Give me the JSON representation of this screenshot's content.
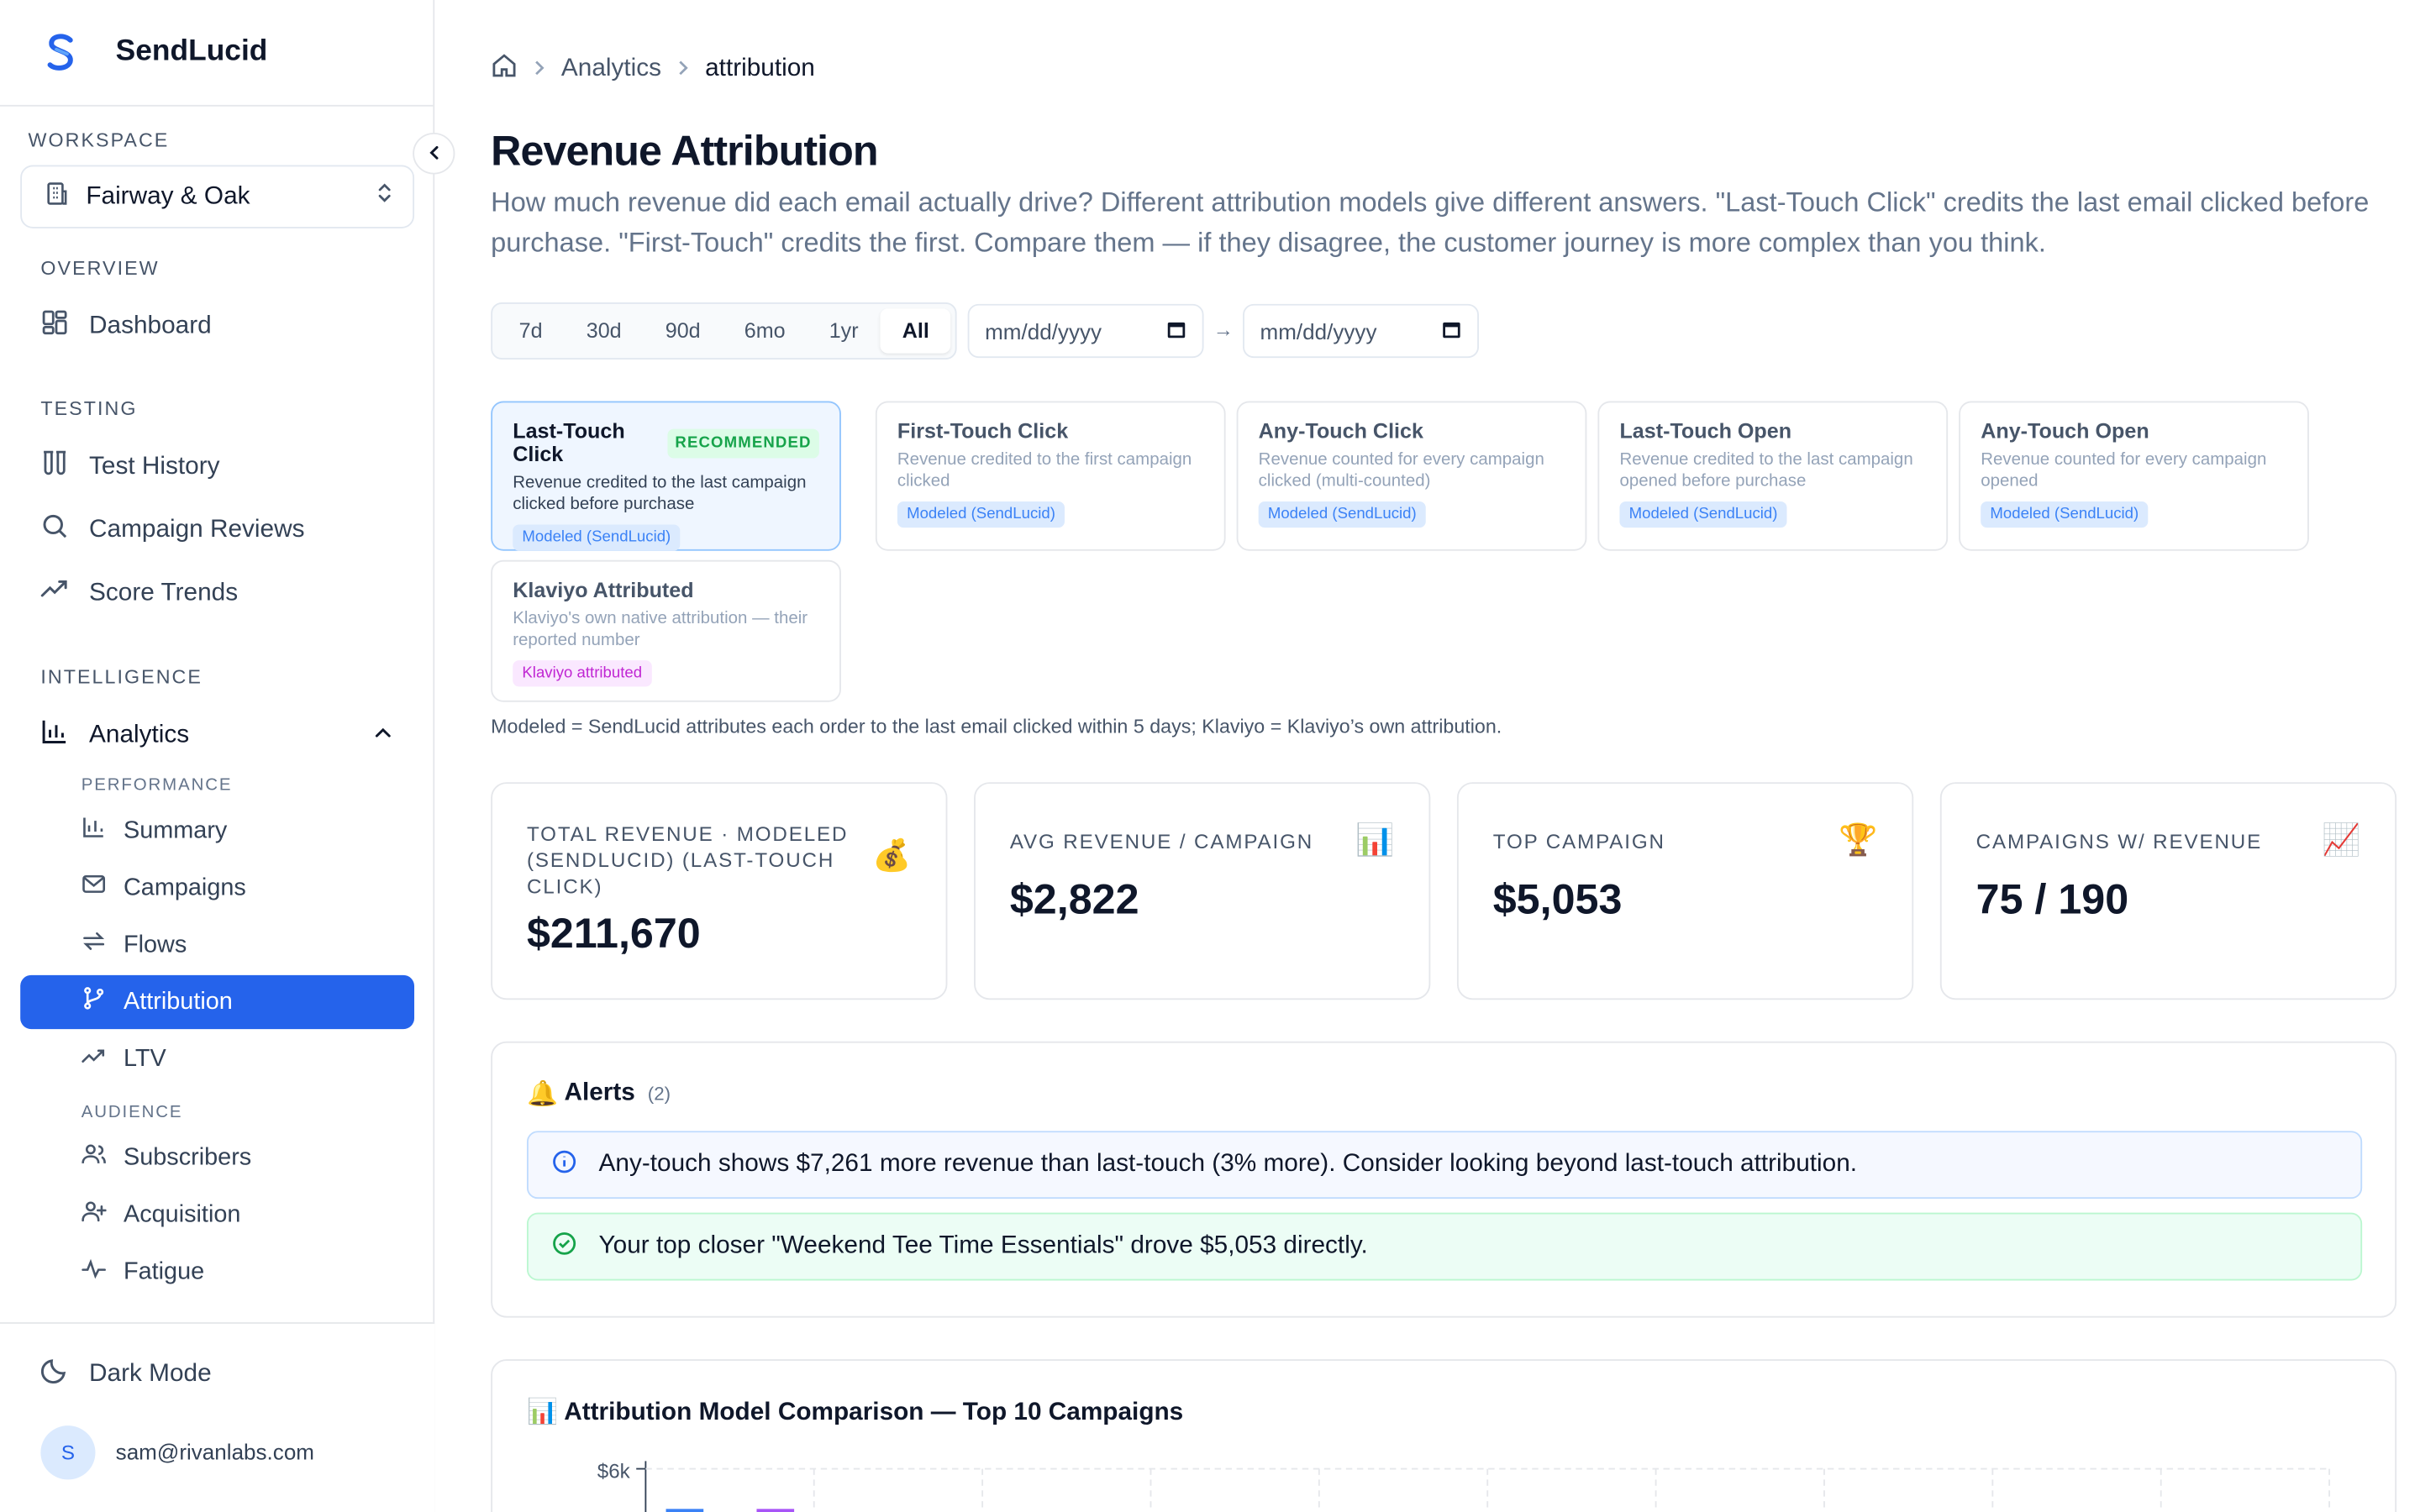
{
  "brand": {
    "name": "SendLucid"
  },
  "sidebar": {
    "workspace_label": "WORKSPACE",
    "workspace_name": "Fairway & Oak",
    "overview_label": "OVERVIEW",
    "dashboard": "Dashboard",
    "testing_label": "TESTING",
    "test_history": "Test History",
    "campaign_reviews": "Campaign Reviews",
    "score_trends": "Score Trends",
    "intelligence_label": "INTELLIGENCE",
    "analytics": "Analytics",
    "performance_label": "PERFORMANCE",
    "summary": "Summary",
    "campaigns": "Campaigns",
    "flows": "Flows",
    "attribution": "Attribution",
    "ltv": "LTV",
    "audience_label": "AUDIENCE",
    "subscribers": "Subscribers",
    "acquisition": "Acquisition",
    "fatigue": "Fatigue",
    "dark_mode": "Dark Mode",
    "user_initial": "S",
    "user_email": "sam@rivanlabs.com"
  },
  "breadcrumb": {
    "parent": "Analytics",
    "current": "attribution"
  },
  "page": {
    "title": "Revenue Attribution",
    "description": "How much revenue did each email actually drive? Different attribution models give different answers. \"Last-Touch Click\" credits the last email clicked before purchase. \"First-Touch\" credits the first. Compare them — if they disagree, the customer journey is more complex than you think."
  },
  "ranges": [
    "7d",
    "30d",
    "90d",
    "6mo",
    "1yr",
    "All"
  ],
  "active_range": "All",
  "date_from": {
    "placeholder": "mm/dd/yyyy"
  },
  "date_to": {
    "placeholder": "mm/dd/yyyy"
  },
  "date_arrow": "→",
  "models": [
    {
      "title": "Last-Touch Click",
      "badge": "RECOMMENDED",
      "desc": "Revenue credited to the last campaign clicked before purchase",
      "tag": "Modeled (SendLucid)"
    },
    {
      "title": "First-Touch Click",
      "desc": "Revenue credited to the first campaign clicked",
      "tag": "Modeled (SendLucid)"
    },
    {
      "title": "Any-Touch Click",
      "desc": "Revenue counted for every campaign clicked (multi-counted)",
      "tag": "Modeled (SendLucid)"
    },
    {
      "title": "Last-Touch Open",
      "desc": "Revenue credited to the last campaign opened before purchase",
      "tag": "Modeled (SendLucid)"
    },
    {
      "title": "Any-Touch Open",
      "desc": "Revenue counted for every campaign opened",
      "tag": "Modeled (SendLucid)"
    },
    {
      "title": "Klaviyo Attributed",
      "desc": "Klaviyo's own native attribution — their reported number",
      "tag": "Klaviyo attributed"
    }
  ],
  "models_note": "Modeled = SendLucid attributes each order to the last email clicked within 5 days; Klaviyo = Klaviyo’s own attribution.",
  "kpis": [
    {
      "label": "TOTAL REVENUE · MODELED (SENDLUCID) (LAST-TOUCH CLICK)",
      "value": "$211,670",
      "icon": "💰"
    },
    {
      "label": "AVG REVENUE / CAMPAIGN",
      "value": "$2,822",
      "icon": "📊"
    },
    {
      "label": "TOP CAMPAIGN",
      "value": "$5,053",
      "icon": "🏆"
    },
    {
      "label": "CAMPAIGNS W/ REVENUE",
      "value": "75 / 190",
      "icon": "📈"
    }
  ],
  "alerts": {
    "icon": "🔔",
    "title": "Alerts",
    "count": "(2)",
    "info_text": "Any-touch shows $7,261 more revenue than last-touch (3% more). Consider looking beyond last-touch attribution.",
    "success_text": "Your top closer \"Weekend Tee Time Essentials\" drove $5,053 directly."
  },
  "chart_section": {
    "title": "📊 Attribution Model Comparison — Top 10 Campaigns",
    "y_tick_top": "$6k"
  },
  "colors": {
    "accent": "#2563eb",
    "series_a": "#3b82f6",
    "series_b": "#a855f7"
  }
}
